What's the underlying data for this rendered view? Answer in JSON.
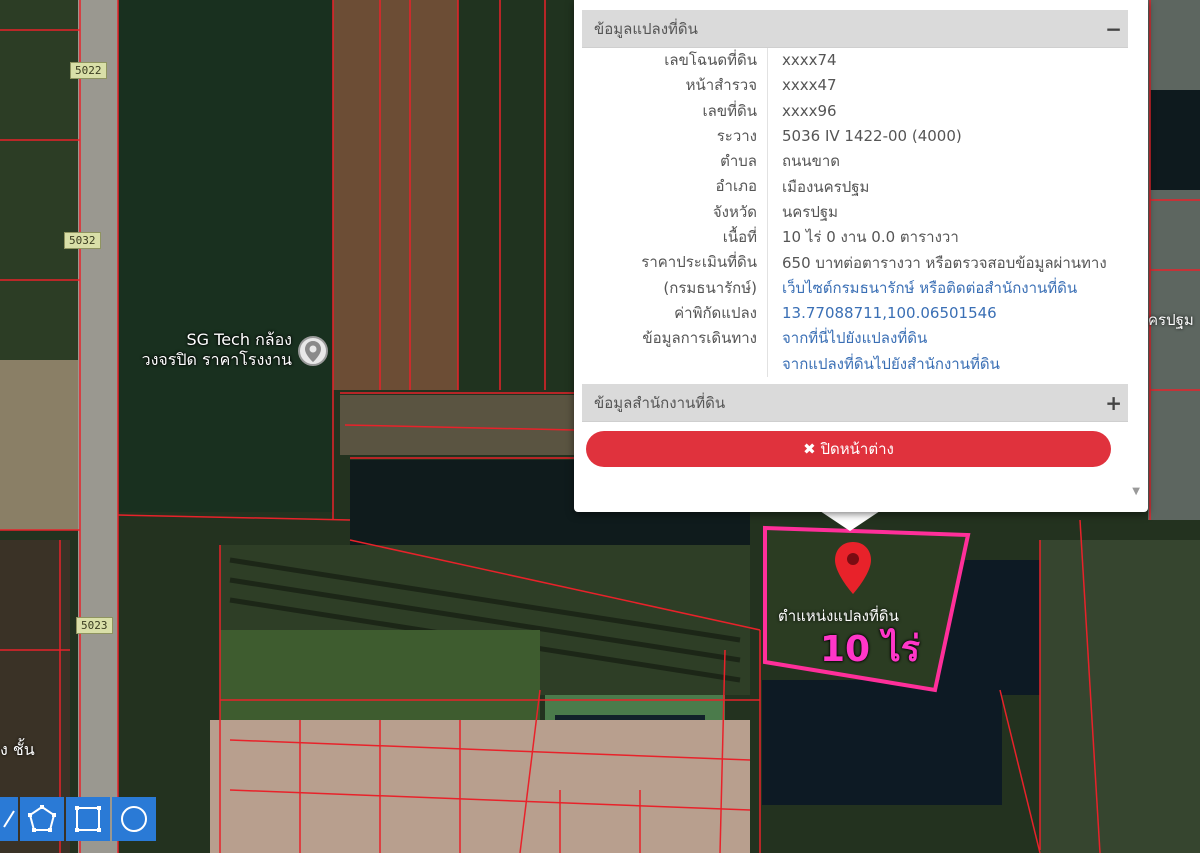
{
  "map": {
    "place_label": "SG Tech กล้อง\nวงจรปิด ราคาโรงงาน",
    "edge_label_left": "ง ชั้น",
    "edge_label_right": "ครปฐม",
    "road_shields": [
      "5022",
      "5032",
      "5023"
    ],
    "parcel_marker_label": "ตำแหน่งแปลงที่ดิน",
    "parcel_area_label": "10 ไร่",
    "parcel_highlight_color": "#ff2f9a",
    "parcel_line_color": "#e8222a"
  },
  "popup": {
    "section1_title": "ข้อมูลแปลงที่ดิน",
    "section1_toggle": "−",
    "fields": [
      {
        "label": "เลขโฉนดที่ดิน",
        "value": "xxxx74"
      },
      {
        "label": "หน้าสำรวจ",
        "value": "xxxx47"
      },
      {
        "label": "เลขที่ดิน",
        "value": "xxxx96"
      },
      {
        "label": "ระวาง",
        "value": "5036 IV 1422-00 (4000)"
      },
      {
        "label": "ตำบล",
        "value": "ถนนขาด"
      },
      {
        "label": "อำเภอ",
        "value": "เมืองนครปฐม"
      },
      {
        "label": "จังหวัด",
        "value": "นครปฐม"
      },
      {
        "label": "เนื้อที่",
        "value": "10 ไร่ 0 งาน 0.0 ตารางวา"
      },
      {
        "label": "ราคาประเมินที่ดิน",
        "value": "650 บาทต่อตารางวา หรือตรวจสอบข้อมูลผ่านทาง"
      },
      {
        "label": "(กรมธนารักษ์)",
        "value": "เว็บไซต์กรมธนารักษ์ หรือติดต่อสำนักงานที่ดิน"
      },
      {
        "label": "ค่าพิกัดแปลง",
        "value": "13.77088711,100.06501546"
      },
      {
        "label": "ข้อมูลการเดินทาง",
        "value": "จากที่นี่ไปยังแปลงที่ดิน"
      },
      {
        "label": "",
        "value": "จากแปลงที่ดินไปยังสำนักงานที่ดิน"
      }
    ],
    "section2_title": "ข้อมูลสำนักงานที่ดิน",
    "section2_toggle": "+",
    "close_button": "✖ ปิดหน้าต่าง",
    "link_color": "#3a6fb5",
    "button_color": "#e0323d"
  },
  "toolbar": {
    "tools": [
      "line-draw-icon",
      "polygon-draw-icon",
      "rectangle-draw-icon",
      "circle-draw-icon"
    ],
    "accent": "#2a7ad6"
  }
}
